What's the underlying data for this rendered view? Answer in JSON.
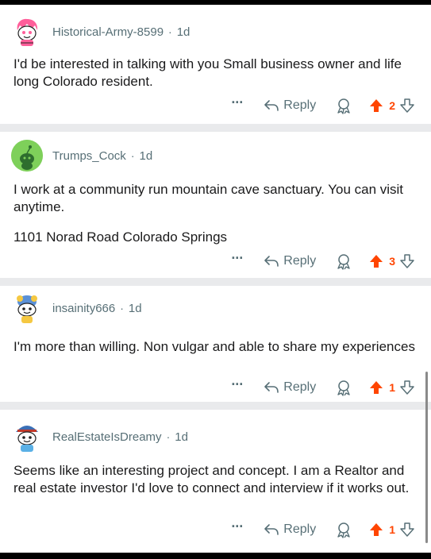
{
  "comments": [
    {
      "username": "Historical-Army-8599",
      "age": "1d",
      "paragraphs": [
        "I'd be interested in talking with you Small business owner and life long Colorado resident."
      ],
      "reply_label": "Reply",
      "score": "2",
      "avatar": "pink-snoo-avatar"
    },
    {
      "username": "Trumps_Cock",
      "age": "1d",
      "paragraphs": [
        "I work at a community run mountain cave sanctuary. You can visit anytime.",
        "1101 Norad Road Colorado Springs"
      ],
      "reply_label": "Reply",
      "score": "3",
      "avatar": "green-snoo-avatar"
    },
    {
      "username": "insainity666",
      "age": "1d",
      "paragraphs": [
        "I'm more than willing. Non vulgar and able to share my experiences"
      ],
      "reply_label": "Reply",
      "score": "1",
      "avatar": "blue-hat-snoo-avatar"
    },
    {
      "username": "RealEstateIsDreamy",
      "age": "1d",
      "paragraphs": [
        "Seems like an interesting project and concept. I am a Realtor and real estate investor I'd love to connect and interview if it works out."
      ],
      "reply_label": "Reply",
      "score": "1",
      "avatar": "cap-snoo-avatar"
    }
  ],
  "icons": {
    "more": "more-options-icon",
    "reply": "reply-arrow-icon",
    "award": "award-icon",
    "upvote": "upvote-arrow-icon",
    "downvote": "downvote-arrow-icon"
  },
  "colors": {
    "upvoted": "#ff4500",
    "meta_text": "#576f76",
    "body_text": "#1a1a1b",
    "separator": "#e9eaec"
  }
}
